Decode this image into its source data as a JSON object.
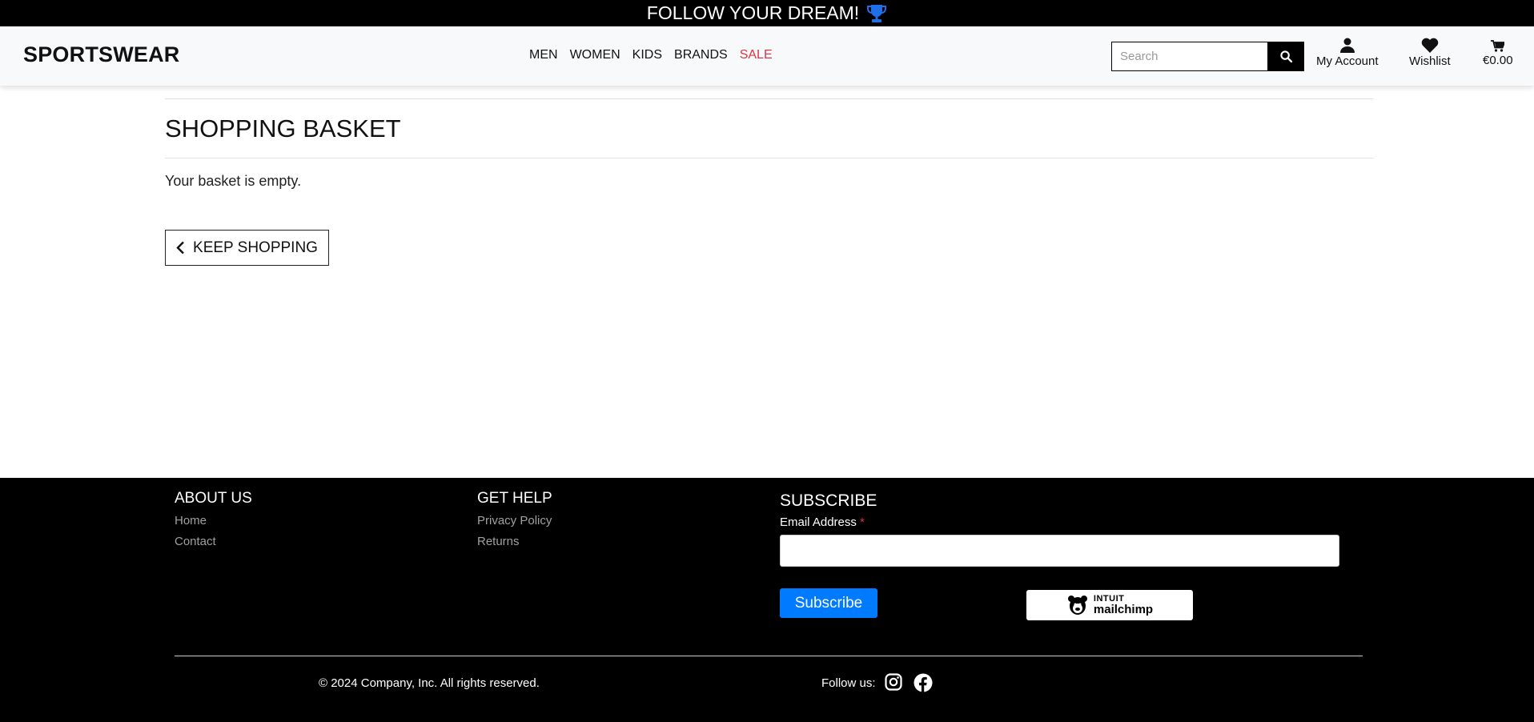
{
  "banner": {
    "text": "FOLLOW YOUR DREAM!",
    "icon": "trophy-icon",
    "icon_color": "#1e6fe8"
  },
  "navbar": {
    "brand": "SPORTSWEAR",
    "menu": [
      {
        "label": "MEN"
      },
      {
        "label": "WOMEN"
      },
      {
        "label": "KIDS"
      },
      {
        "label": "BRANDS"
      },
      {
        "label": "SALE",
        "color": "#dc3545"
      }
    ],
    "search": {
      "placeholder": "Search",
      "icon": "search-icon"
    },
    "account": {
      "label": "My Account",
      "icon": "user-icon"
    },
    "wishlist": {
      "label": "Wishlist",
      "icon": "heart-icon"
    },
    "basket": {
      "label": "€0.00",
      "icon": "cart-icon"
    }
  },
  "main": {
    "title": "SHOPPING BASKET",
    "empty_message": "Your basket is empty.",
    "keep_shopping": "KEEP SHOPPING"
  },
  "footer": {
    "about": {
      "heading": "ABOUT US",
      "links": [
        "Home",
        "Contact"
      ]
    },
    "help": {
      "heading": "GET HELP",
      "links": [
        "Privacy Policy",
        "Returns"
      ]
    },
    "subscribe": {
      "heading": "SUBSCRIBE",
      "email_label": "Email Address",
      "required_mark": "*",
      "button": "Subscribe",
      "button_color": "#007bff",
      "badge_top": "INTUIT",
      "badge_bottom": "mailchimp"
    },
    "copyright": "© 2024 Company, Inc. All rights reserved.",
    "follow_us": "Follow us:",
    "social": [
      "instagram-icon",
      "facebook-icon"
    ]
  }
}
